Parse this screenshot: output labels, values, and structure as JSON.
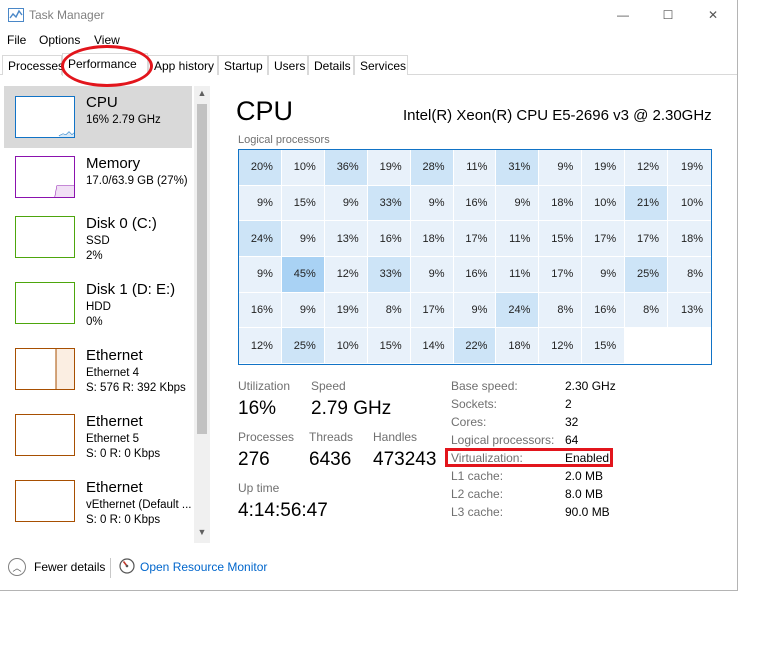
{
  "window": {
    "title": "Task Manager",
    "minimize": "—",
    "maximize": "☐",
    "close": "✕"
  },
  "menu": [
    "File",
    "Options",
    "View"
  ],
  "tabs": [
    "Processes",
    "Performance",
    "App history",
    "Startup",
    "Users",
    "Details",
    "Services"
  ],
  "active_tab": "Performance",
  "sidebar": {
    "items": [
      {
        "title": "CPU",
        "lines": [
          "16% 2.79 GHz"
        ],
        "color": "#1173c6"
      },
      {
        "title": "Memory",
        "lines": [
          "17.0/63.9 GB (27%)"
        ],
        "color": "#8b12ae"
      },
      {
        "title": "Disk 0 (C:)",
        "lines": [
          "SSD",
          "2%"
        ],
        "color": "#4da60c"
      },
      {
        "title": "Disk 1 (D: E:)",
        "lines": [
          "HDD",
          "0%"
        ],
        "color": "#4da60c"
      },
      {
        "title": "Ethernet",
        "lines": [
          "Ethernet 4",
          "S: 576  R: 392 Kbps"
        ],
        "color": "#a74f01"
      },
      {
        "title": "Ethernet",
        "lines": [
          "Ethernet 5",
          "S: 0  R: 0 Kbps"
        ],
        "color": "#a74f01"
      },
      {
        "title": "Ethernet",
        "lines": [
          "vEthernet (Default ...",
          "S: 0  R: 0 Kbps"
        ],
        "color": "#a74f01"
      }
    ],
    "scroll_up": "▲",
    "scroll_down": "▼"
  },
  "main": {
    "title": "CPU",
    "model": "Intel(R) Xeon(R) CPU E5-2696 v3 @ 2.30GHz",
    "logical_label": "Logical processors",
    "grid_values": [
      20,
      10,
      36,
      19,
      28,
      11,
      31,
      9,
      19,
      12,
      19,
      9,
      15,
      9,
      33,
      9,
      16,
      9,
      18,
      10,
      21,
      10,
      24,
      9,
      13,
      16,
      18,
      17,
      11,
      15,
      17,
      17,
      18,
      9,
      45,
      12,
      33,
      9,
      16,
      11,
      17,
      9,
      25,
      8,
      16,
      9,
      19,
      8,
      17,
      9,
      24,
      8,
      16,
      8,
      13,
      12,
      25,
      10,
      15,
      14,
      22,
      18,
      12,
      15
    ],
    "accent": "#1173c6",
    "stats": {
      "utilization_label": "Utilization",
      "utilization_value": "16%",
      "speed_label": "Speed",
      "speed_value": "2.79 GHz",
      "processes_label": "Processes",
      "processes_value": "276",
      "threads_label": "Threads",
      "threads_value": "6436",
      "handles_label": "Handles",
      "handles_value": "473243",
      "uptime_label": "Up time",
      "uptime_value": "4:14:56:47"
    },
    "specs": [
      {
        "label": "Base speed:",
        "value": "2.30 GHz"
      },
      {
        "label": "Sockets:",
        "value": "2"
      },
      {
        "label": "Cores:",
        "value": "32"
      },
      {
        "label": "Logical processors:",
        "value": "64"
      },
      {
        "label": "Virtualization:",
        "value": "Enabled"
      },
      {
        "label": "L1 cache:",
        "value": "2.0 MB"
      },
      {
        "label": "L2 cache:",
        "value": "8.0 MB"
      },
      {
        "label": "L3 cache:",
        "value": "90.0 MB"
      }
    ]
  },
  "footer": {
    "fewer_icon": "︿",
    "fewer_details": "Fewer details",
    "resource_monitor": "Open Resource Monitor"
  },
  "annotation_color": "#e2151c"
}
